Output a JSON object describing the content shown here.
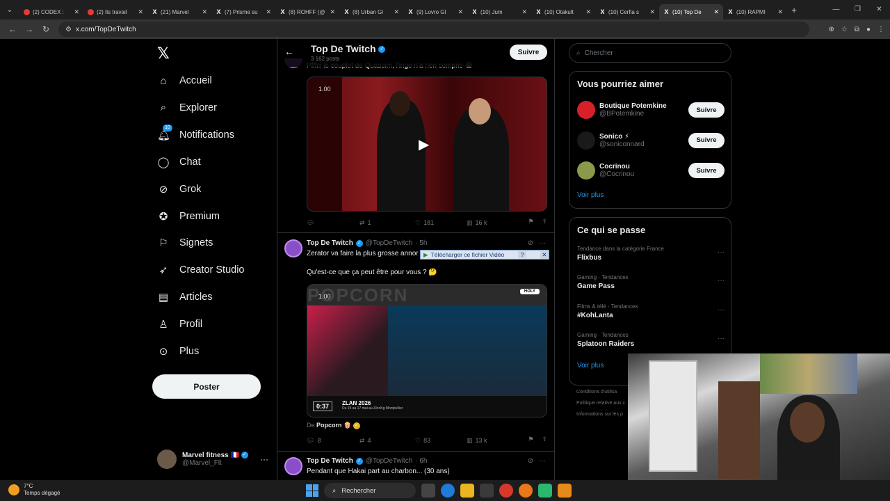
{
  "browser": {
    "tabs": [
      {
        "title": "(2) CODEX :",
        "icon": "youtube-icon",
        "active": false
      },
      {
        "title": "(2) Ils travail",
        "icon": "youtube-icon",
        "active": false
      },
      {
        "title": "(21) Marvel",
        "icon": "x-icon",
        "active": false
      },
      {
        "title": "(7) Prisme su",
        "icon": "x-icon",
        "active": false
      },
      {
        "title": "(8) ROHFF (@",
        "icon": "x-icon",
        "active": false
      },
      {
        "title": "(8) Urban Gl",
        "icon": "x-icon",
        "active": false
      },
      {
        "title": "(9) Lovro Gl",
        "icon": "x-icon",
        "active": false
      },
      {
        "title": "(10) Jum",
        "icon": "x-icon",
        "active": false
      },
      {
        "title": "(10) Otakult",
        "icon": "x-icon",
        "active": false
      },
      {
        "title": "(10) Cerfia s",
        "icon": "x-icon",
        "active": false
      },
      {
        "title": "(10) Top De",
        "icon": "x-icon",
        "active": true
      },
      {
        "title": "(10) RAPMI",
        "icon": "x-icon",
        "active": false
      }
    ],
    "url": "x.com/TopDeTwitch"
  },
  "nav": {
    "items": [
      {
        "label": "Accueil",
        "icon": "home-icon"
      },
      {
        "label": "Explorer",
        "icon": "search-icon"
      },
      {
        "label": "Notifications",
        "icon": "bell-icon",
        "badge": "10"
      },
      {
        "label": "Chat",
        "icon": "chat-icon"
      },
      {
        "label": "Grok",
        "icon": "grok-icon"
      },
      {
        "label": "Premium",
        "icon": "premium-icon"
      },
      {
        "label": "Signets",
        "icon": "bookmark-icon"
      },
      {
        "label": "Creator Studio",
        "icon": "rocket-icon"
      },
      {
        "label": "Articles",
        "icon": "articles-icon"
      },
      {
        "label": "Profil",
        "icon": "user-icon"
      },
      {
        "label": "Plus",
        "icon": "more-icon"
      }
    ],
    "post_label": "Poster",
    "account": {
      "display_name": "Marvel fitness 🇫🇷",
      "handle": "@Marvel_Flt"
    }
  },
  "profile_header": {
    "title": "Top De Twitch",
    "posts_count": "3 162 posts",
    "follow_label": "Suivre"
  },
  "tweets": [
    {
      "text_cut": "Pfffrr le couplet de Quassim, l'inge n'a rien compris 😭",
      "video_speed": "1.00",
      "stats": {
        "replies": "",
        "reposts": "1",
        "likes": "181",
        "views": "16 k"
      }
    },
    {
      "display_name": "Top De Twitch",
      "handle": "@TopDeTwitch",
      "time": "· 5h",
      "text_line1": "Zerator va faire la plus grosse annor",
      "text_line2": "Qu'est-ce que ça peut être pour vous ? 🤔",
      "video_speed": "1.00",
      "video_time": "0:37",
      "video_caption_title": "ZLAN 2026",
      "video_caption_sub": "Du 15 au 17 mai au ZéroKg Montpellier",
      "video_bg_text": "POPCORN",
      "video_logo": "HOLY",
      "via_prefix": "De",
      "via_name": "Popcorn 🍿",
      "stats": {
        "replies": "8",
        "reposts": "4",
        "likes": "83",
        "views": "13 k"
      }
    },
    {
      "display_name": "Top De Twitch",
      "handle": "@TopDeTwitch",
      "time": "· 6h",
      "text_line1": "Pendant que Hakai part au charbon... (30 ans)"
    }
  ],
  "download_bar": {
    "label": "Télécharger ce fichier Vidéo",
    "help": "?"
  },
  "right": {
    "search_placeholder": "Chercher",
    "who_title": "Vous pourriez aimer",
    "who": [
      {
        "name": "Boutique Potemkine",
        "handle": "@BPotemkine",
        "follow": "Suivre",
        "color": "#d8202a"
      },
      {
        "name": "Sonico ⚡",
        "handle": "@soniconnard",
        "follow": "Suivre",
        "color": "#1a1a1a"
      },
      {
        "name": "Cocrinou",
        "handle": "@Cocrinou",
        "follow": "Suivre",
        "color": "#8a9a4a"
      }
    ],
    "voir_plus": "Voir plus",
    "trends_title": "Ce qui se passe",
    "trends": [
      {
        "context": "Tendance dans la catégorie France",
        "title": "Flixbus"
      },
      {
        "context": "Gaming · Tendances",
        "title": "Game Pass"
      },
      {
        "context": "Films & télé · Tendances",
        "title": "#KohLanta"
      },
      {
        "context": "Gaming · Tendances",
        "title": "Splatoon Raiders"
      }
    ],
    "footer": [
      "Conditions d'utilisa",
      "Politique relative aux c",
      "Informations sur les p"
    ]
  },
  "taskbar": {
    "temp": "7°C",
    "weather": "Temps dégagé",
    "search": "Rechercher"
  },
  "colors": {
    "accent": "#1d9bf0",
    "background": "#000000",
    "border": "#2f3336"
  }
}
